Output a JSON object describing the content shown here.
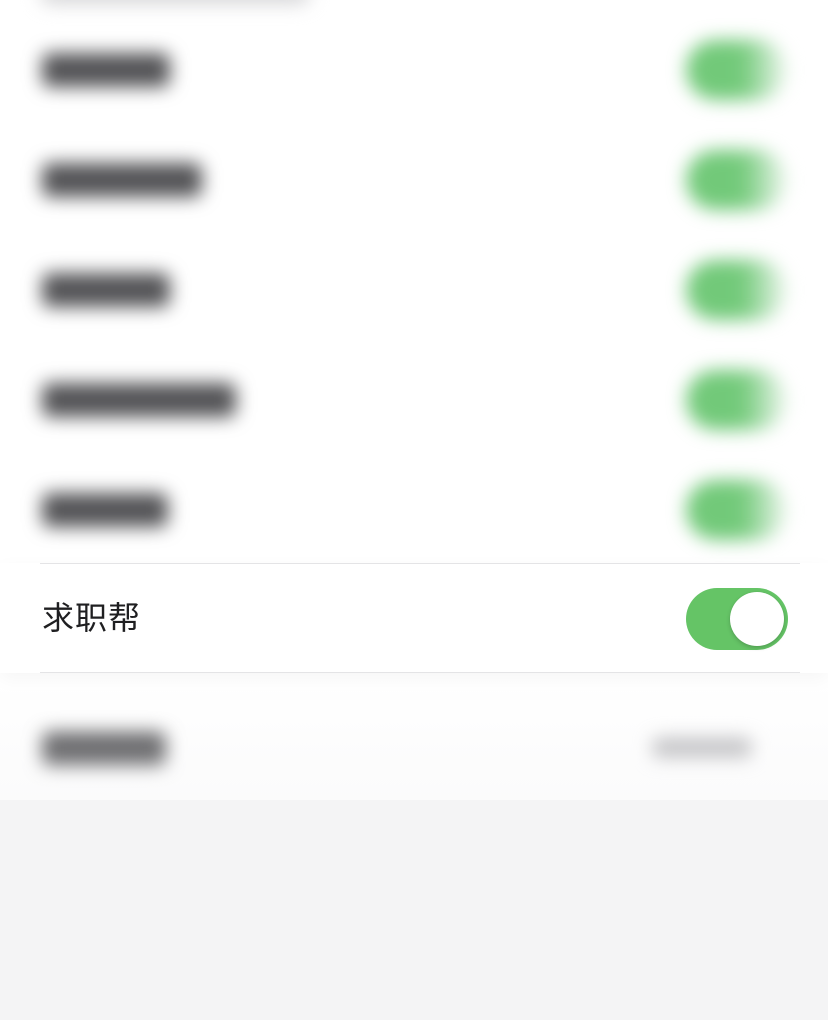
{
  "settings": {
    "blurred_rows": [
      {
        "label": "",
        "toggle_on": true
      },
      {
        "label": "",
        "toggle_on": true
      },
      {
        "label": "",
        "toggle_on": true
      },
      {
        "label": "",
        "toggle_on": true
      },
      {
        "label": "",
        "toggle_on": true
      }
    ],
    "focused_row": {
      "label": "求职帮",
      "toggle_on": true
    },
    "bottom_row": {
      "label": "",
      "value": ""
    },
    "colors": {
      "toggle_on": "#65c466",
      "background": "#f4f4f5",
      "text": "#1f1f21"
    }
  }
}
